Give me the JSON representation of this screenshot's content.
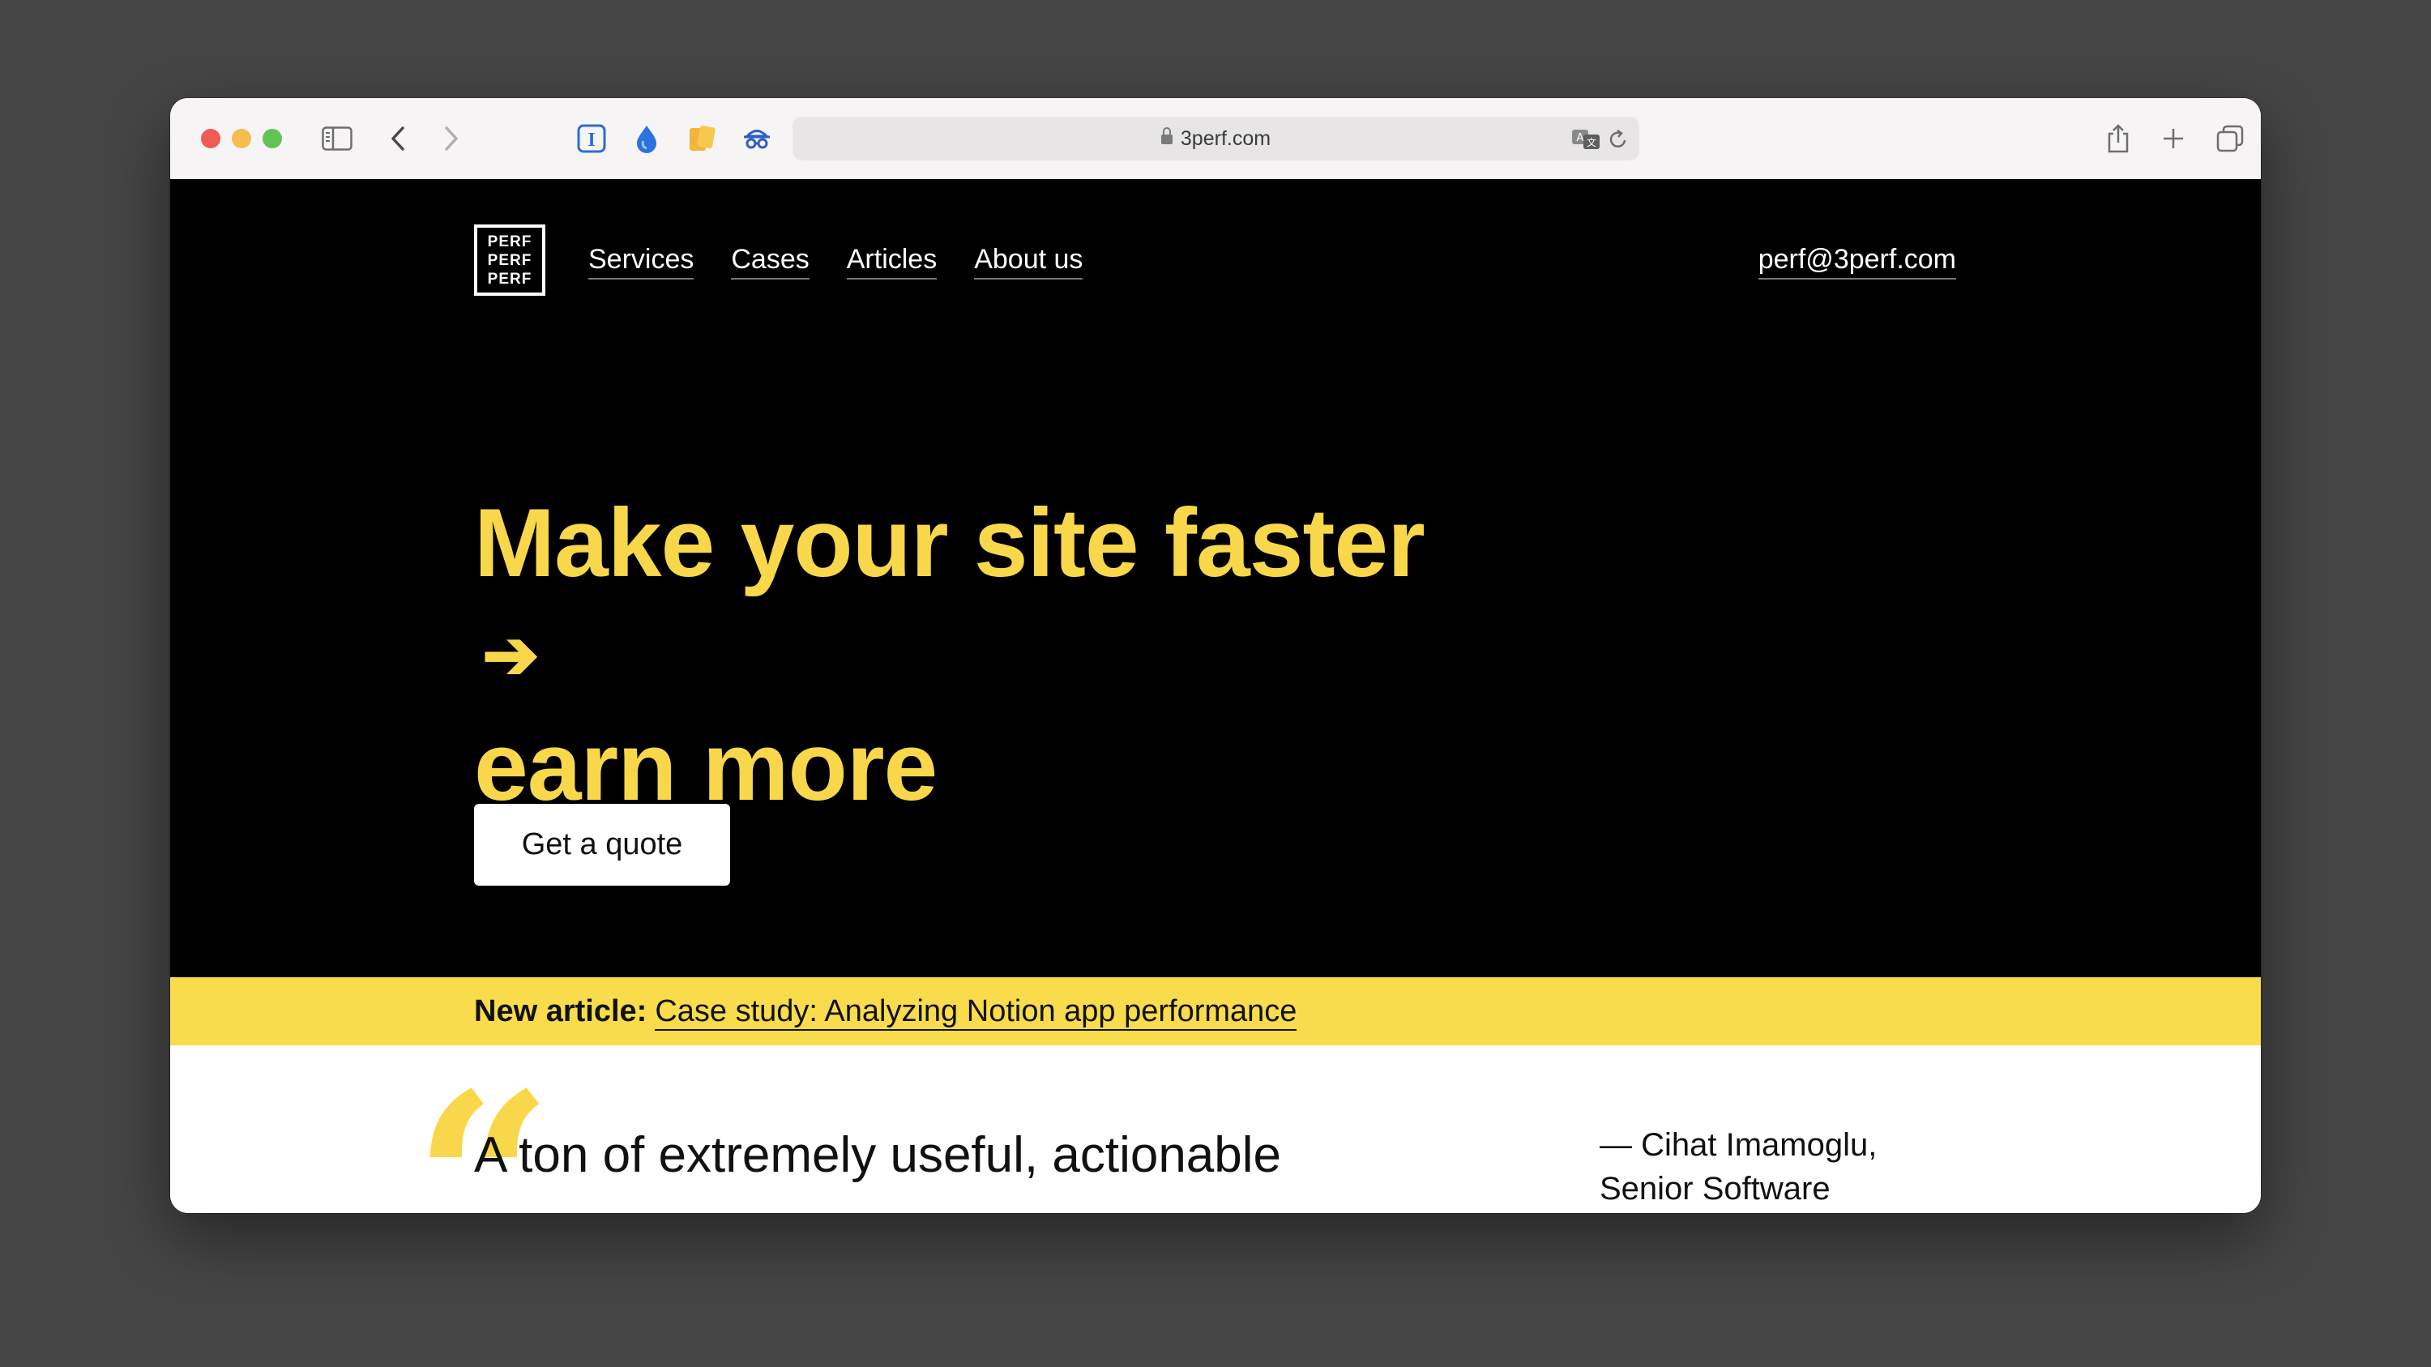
{
  "browser": {
    "url": "3perf.com",
    "icons": [
      "sidebar-icon",
      "back-icon",
      "forward-icon",
      "extension-i-icon",
      "extension-drop-icon",
      "extension-notes-icon",
      "extension-spy-icon",
      "translate-icon",
      "reload-icon",
      "share-icon",
      "new-tab-icon",
      "tabs-overview-icon"
    ]
  },
  "site": {
    "logo_lines": [
      "PERF",
      "PERF",
      "PERF"
    ],
    "nav": [
      "Services",
      "Cases",
      "Articles",
      "About us"
    ],
    "email": "perf@3perf.com"
  },
  "hero": {
    "line1": "Make your site faster",
    "arrow": "➔",
    "line2": "earn more",
    "cta": "Get a quote"
  },
  "banner": {
    "label": "New article:",
    "link": "Case study: Analyzing Notion app performance"
  },
  "testimonial": {
    "quote_mark": "“",
    "text": "A ton of extremely useful, actionable",
    "attribution_line1": "— Cihat Imamoglu,",
    "attribution_line2": "Senior Software"
  },
  "colors": {
    "accent_yellow": "#f8d84a",
    "hero_bg": "#000000",
    "desktop_bg": "#454545"
  }
}
